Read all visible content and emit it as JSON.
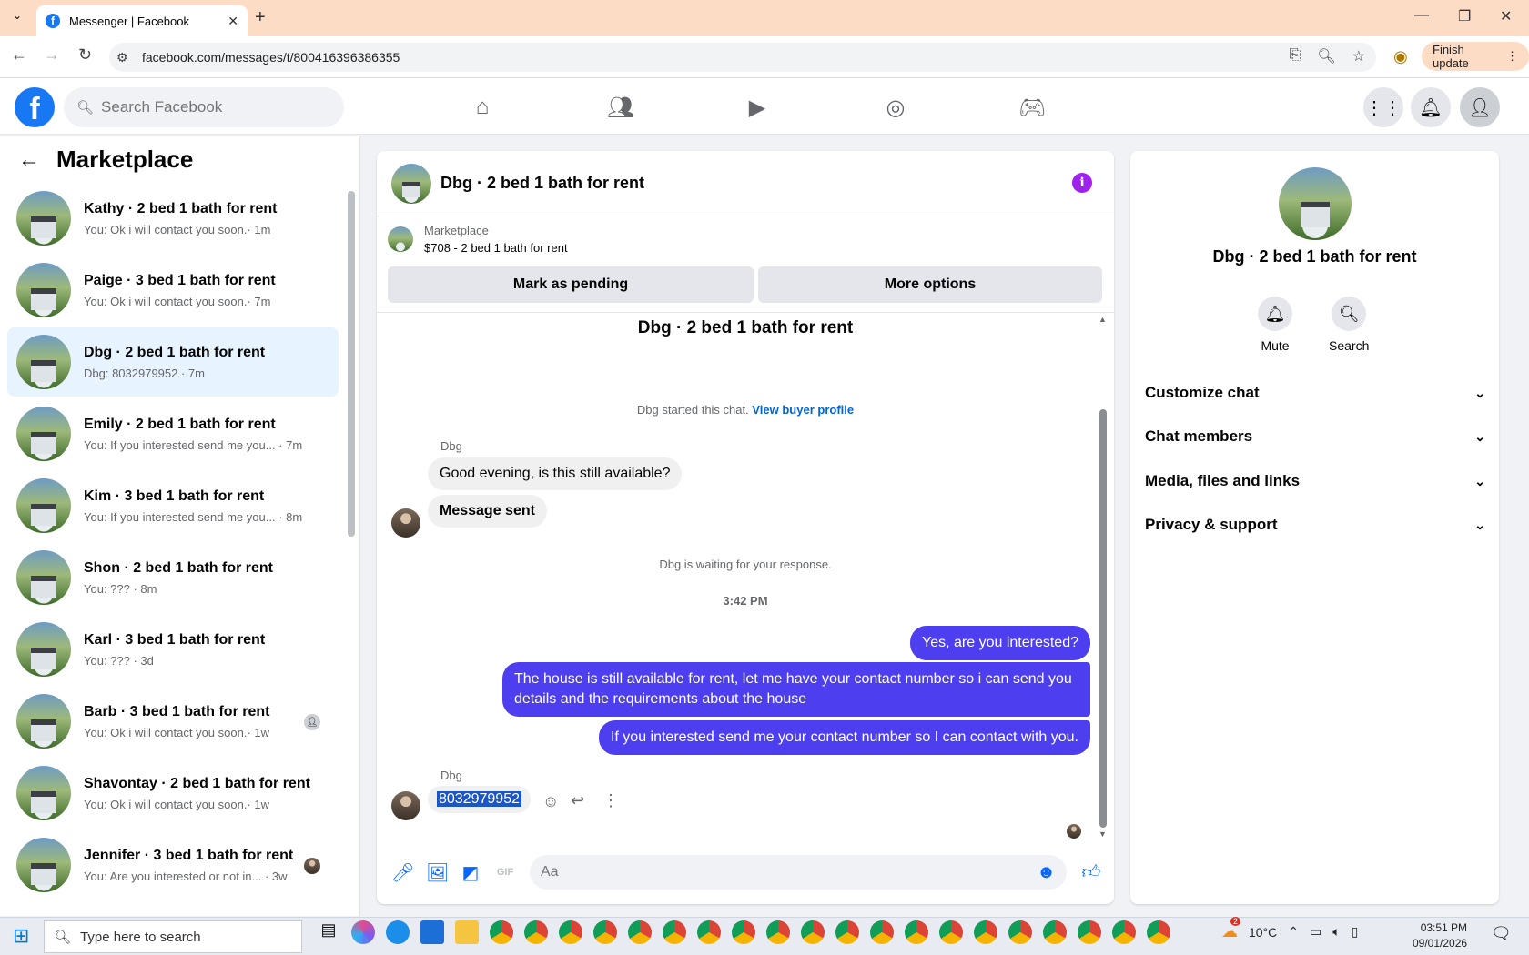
{
  "browser": {
    "tab_title": "Messenger | Facebook",
    "url": "facebook.com/messages/t/800416396386355",
    "finish_update": "Finish update"
  },
  "header": {
    "search_placeholder": "Search Facebook"
  },
  "sidebar": {
    "title": "Marketplace",
    "conversations": [
      {
        "name": "Kathy · 2 bed 1 bath for rent",
        "preview": "You: Ok i will contact you soon.· 1m"
      },
      {
        "name": "Paige · 3 bed 1 bath for rent",
        "preview": "You: Ok i will contact you soon.· 7m"
      },
      {
        "name": "Dbg · 2 bed 1 bath for rent",
        "preview": "Dbg: 8032979952 · 7m"
      },
      {
        "name": "Emily · 2 bed 1 bath for rent",
        "preview": "You: If you interested send me you... · 7m"
      },
      {
        "name": "Kim · 3 bed 1 bath for rent",
        "preview": "You: If you interested send me you... · 8m"
      },
      {
        "name": "Shon · 2 bed 1 bath for rent",
        "preview": "You: ??? · 8m"
      },
      {
        "name": "Karl · 3 bed 1 bath for rent",
        "preview": "You: ??? · 3d"
      },
      {
        "name": "Barb · 3 bed 1 bath for rent",
        "preview": "You: Ok i will contact you soon.· 1w"
      },
      {
        "name": "Shavontay · 2 bed 1 bath for rent",
        "preview": "You: Ok i will contact you soon.· 1w"
      },
      {
        "name": "Jennifer · 3 bed 1 bath for rent",
        "preview": "You: Are you interested or not in... · 3w"
      }
    ]
  },
  "chat": {
    "title": "Dbg · 2 bed 1 bath for rent",
    "marketplace_label": "Marketplace",
    "listing": "$708 - 2 bed 1 bath for rent",
    "mark_pending": "Mark as pending",
    "more_options": "More options",
    "center_title": "Dbg · 2 bed 1 bath for rent",
    "started_text": "Dbg started this chat.",
    "view_buyer": "View buyer profile",
    "sender": "Dbg",
    "msg_in_1": "Good evening, is this still available?",
    "msg_in_2": "Message sent",
    "waiting": "Dbg is waiting for your response.",
    "time": "3:42 PM",
    "msg_out_1": "Yes, are you interested?",
    "msg_out_2": "The house is still available for rent, let me have your contact number so i can send you details and the requirements about the house",
    "msg_out_3": "If you interested send me your contact number so I can contact with you.",
    "sender_2": "Dbg",
    "msg_in_3": "8032979952",
    "composer_placeholder": "Aa"
  },
  "details": {
    "name": "Dbg · 2 bed 1 bath for rent",
    "mute": "Mute",
    "search": "Search",
    "sections": [
      "Customize chat",
      "Chat members",
      "Media, files and links",
      "Privacy & support"
    ]
  },
  "taskbar": {
    "search_placeholder": "Type here to search",
    "temperature": "10°C",
    "time": "03:51 PM",
    "date": "09/01/2026",
    "weather_badge": "2"
  }
}
